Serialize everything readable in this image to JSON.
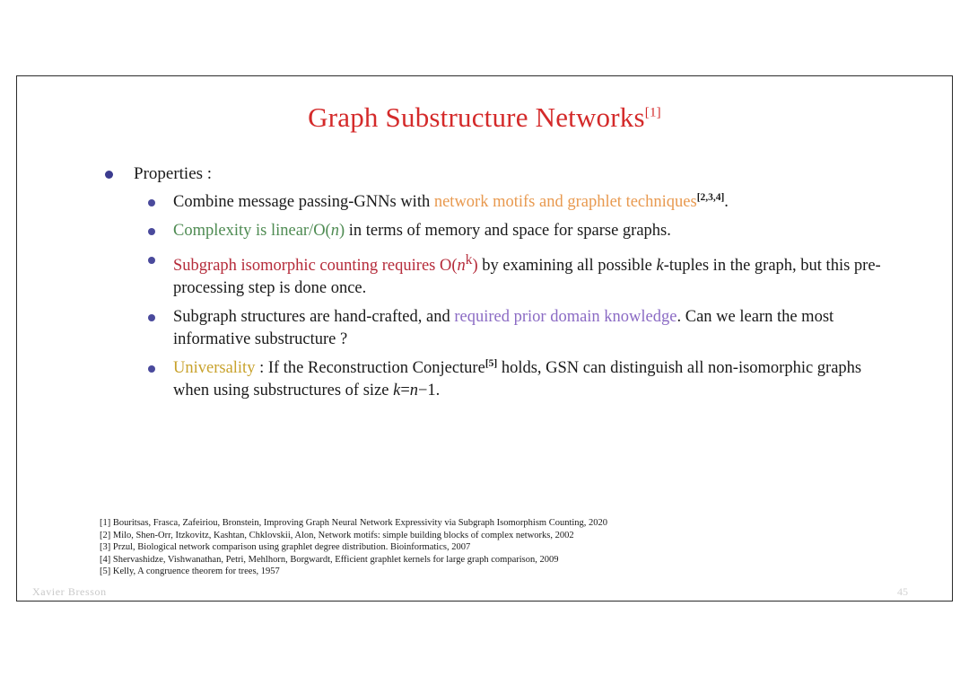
{
  "slide": {
    "title": "Graph Substructure Networks",
    "title_ref": "[1]",
    "page_number": "45",
    "author": "Xavier Bresson"
  },
  "content": {
    "heading": "Properties :",
    "items": [
      {
        "id": "combine",
        "parts": [
          {
            "text": "Combine message passing-GNNs with ",
            "style": "plain"
          },
          {
            "text": "network motifs and graphlet techniques",
            "style": "orange"
          },
          {
            "text": "[2,3,4]",
            "style": "ref"
          },
          {
            "text": ".",
            "style": "plain"
          }
        ]
      },
      {
        "id": "complexity",
        "parts": [
          {
            "text": "Complexity is linear/O(",
            "style": "green"
          },
          {
            "text": "n",
            "style": "green-italic"
          },
          {
            "text": ")",
            "style": "green"
          },
          {
            "text": " in terms of memory and space for sparse graphs.",
            "style": "plain"
          }
        ]
      },
      {
        "id": "subgraph-counting",
        "parts": [
          {
            "text": "Subgraph isomorphic counting requires O(",
            "style": "red"
          },
          {
            "text": "n",
            "style": "red-italic"
          },
          {
            "text": "k",
            "style": "red-sup"
          },
          {
            "text": ")",
            "style": "red"
          },
          {
            "text": " by examining all possible ",
            "style": "plain"
          },
          {
            "text": "k",
            "style": "italic"
          },
          {
            "text": "-tuples in the graph, but this pre-processing step is done once.",
            "style": "plain"
          }
        ]
      },
      {
        "id": "hand-crafted",
        "parts": [
          {
            "text": "Subgraph structures are hand-crafted, and ",
            "style": "plain"
          },
          {
            "text": "required prior domain knowledge",
            "style": "purple"
          },
          {
            "text": ". Can we learn the most informative substructure ?",
            "style": "plain"
          }
        ]
      },
      {
        "id": "universality",
        "parts": [
          {
            "text": "Universality",
            "style": "gold"
          },
          {
            "text": " : If the Reconstruction Conjecture",
            "style": "plain"
          },
          {
            "text": "[5]",
            "style": "ref"
          },
          {
            "text": " holds, GSN can distinguish all non-isomorphic graphs when using substructures of size ",
            "style": "plain"
          },
          {
            "text": "k",
            "style": "italic"
          },
          {
            "text": "=",
            "style": "plain"
          },
          {
            "text": "n",
            "style": "italic"
          },
          {
            "text": "−1.",
            "style": "plain"
          }
        ]
      }
    ]
  },
  "references": [
    "[1] Bouritsas, Frasca, Zafeiriou, Bronstein, Improving Graph Neural Network Expressivity via Subgraph Isomorphism Counting, 2020",
    "[2] Milo, Shen-Orr, Itzkovitz, Kashtan, Chklovskii, Alon, Network motifs: simple building blocks of complex networks, 2002",
    "[3] Przul, Biological network comparison using graphlet degree distribution. Bioinformatics, 2007",
    "[4] Shervashidze, Vishwanathan, Petri, Mehlhorn, Borgwardt, Efficient graphlet kernels for large graph comparison, 2009",
    "[5] Kelly, A congruence theorem for trees, 1957"
  ],
  "colors": {
    "title": "#d42a2a",
    "orange": "#e8994f",
    "green": "#4e8b52",
    "red": "#b52b3a",
    "purple": "#8b6bc4",
    "gold": "#c8a22c",
    "bullet": "#3b3b8f"
  }
}
